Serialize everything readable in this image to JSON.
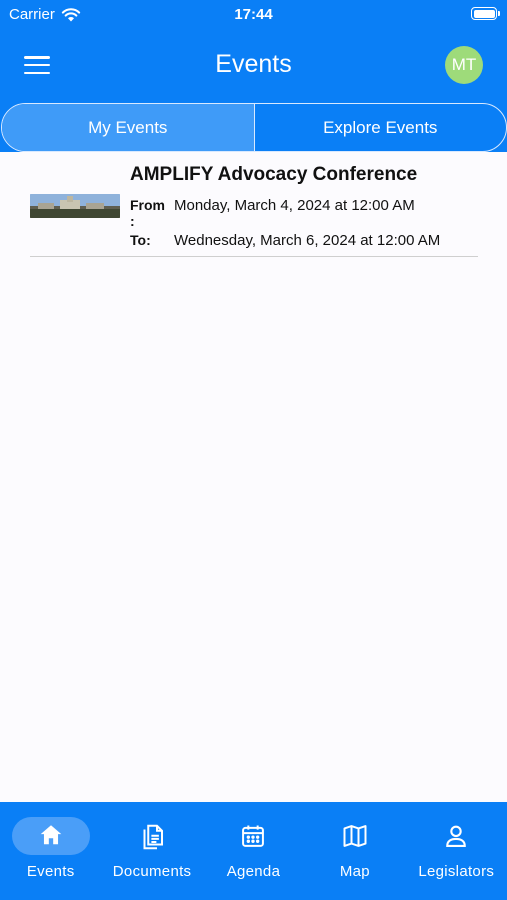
{
  "status_bar": {
    "carrier": "Carrier",
    "time": "17:44"
  },
  "header": {
    "title": "Events",
    "avatar_initials": "MT"
  },
  "tabs": [
    {
      "label": "My Events",
      "active": true
    },
    {
      "label": "Explore Events",
      "active": false
    }
  ],
  "events": [
    {
      "title": "AMPLIFY Advocacy Conference",
      "from_label": "From",
      "from_colon": ":",
      "from_value": "Monday, March 4, 2024 at 12:00 AM",
      "to_label": "To:",
      "to_value": "Wednesday, March 6, 2024  at 12:00 AM"
    }
  ],
  "bottom_nav": [
    {
      "label": "Events",
      "icon": "home-icon",
      "active": true
    },
    {
      "label": "Documents",
      "icon": "documents-icon",
      "active": false
    },
    {
      "label": "Agenda",
      "icon": "calendar-icon",
      "active": false
    },
    {
      "label": "Map",
      "icon": "map-icon",
      "active": false
    },
    {
      "label": "Legislators",
      "icon": "person-icon",
      "active": false
    }
  ],
  "colors": {
    "primary": "#0a7ff6",
    "active_tab": "#3f9bf8",
    "avatar": "#9edb7a",
    "background": "#fcfbfe"
  }
}
